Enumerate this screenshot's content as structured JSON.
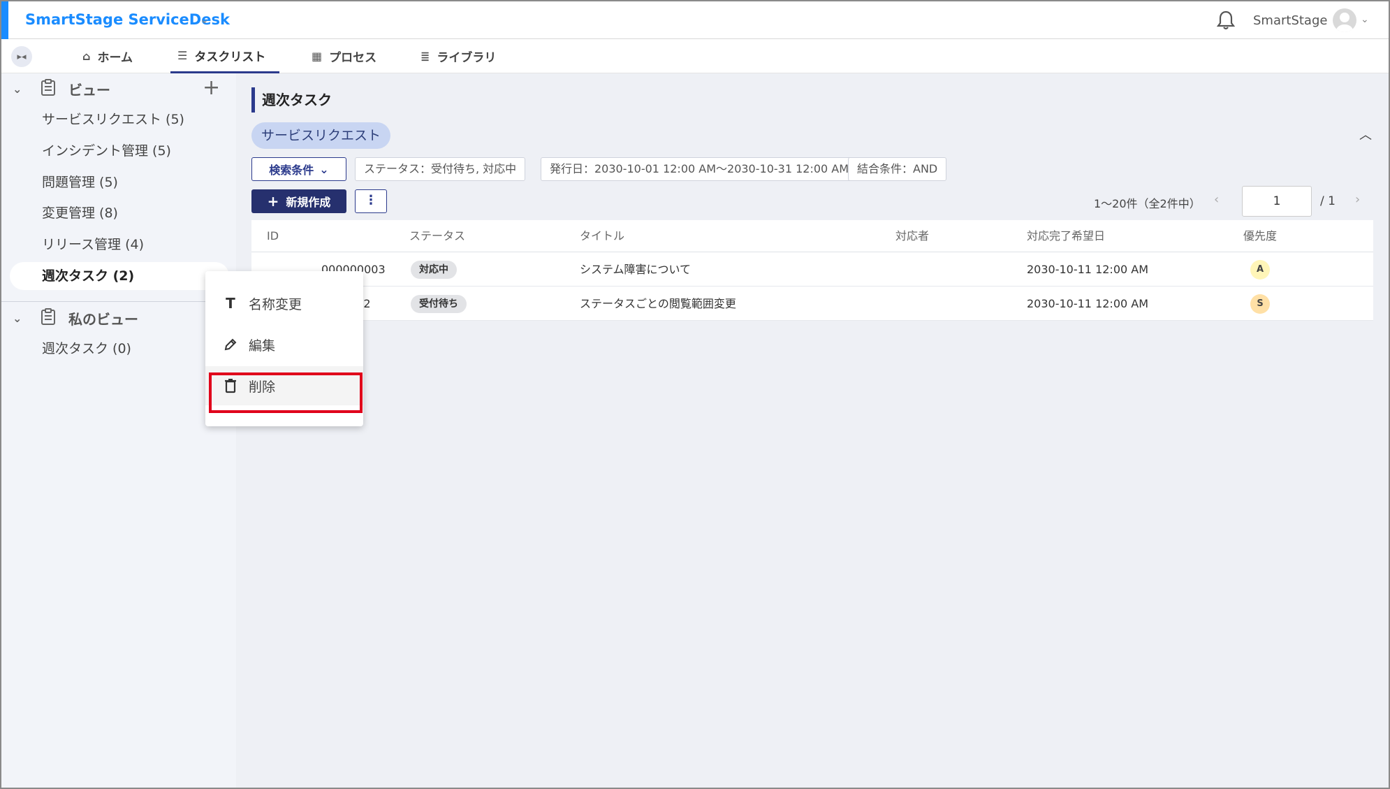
{
  "header": {
    "app_title": "SmartStage ServiceDesk",
    "user_name": "SmartStage",
    "icons": [
      "bell-icon",
      "avatar-icon",
      "chevron-down-icon"
    ]
  },
  "nav": {
    "tabs": [
      {
        "label": "ホーム",
        "icon": "home-icon",
        "active": false
      },
      {
        "label": "タスクリスト",
        "icon": "checklist-icon",
        "active": true
      },
      {
        "label": "プロセス",
        "icon": "building-icon",
        "active": false
      },
      {
        "label": "ライブラリ",
        "icon": "list-icon",
        "active": false
      }
    ]
  },
  "sidebar": {
    "views_title": "ビュー",
    "items": [
      {
        "label": "サービスリクエスト (5)"
      },
      {
        "label": "インシデント管理 (5)"
      },
      {
        "label": "問題管理 (5)"
      },
      {
        "label": "変更管理 (8)"
      },
      {
        "label": "リリース管理 (4)"
      },
      {
        "label": "週次タスク (2)",
        "active": true
      }
    ],
    "my_views_title": "私のビュー",
    "my_items": [
      {
        "label": "週次タスク (0)"
      }
    ]
  },
  "main": {
    "page_title": "週次タスク",
    "category_chip": "サービスリクエスト",
    "filter_button": "検索条件",
    "filters": [
      "ステータス：受付待ち, 対応中",
      "発行日：2030-10-01 12:00 AM〜2030-10-31 12:00 AM",
      "結合条件：AND"
    ],
    "new_button": "新規作成",
    "more_button": "⋮",
    "pager": {
      "summary": "1〜20件（全2件中）",
      "page": "1",
      "total": "/ 1"
    },
    "table": {
      "headers": [
        "ID",
        "ステータス",
        "タイトル",
        "対応者",
        "対応完了希望日",
        "優先度"
      ],
      "rows": [
        {
          "id": "000000003",
          "status": "対応中",
          "title": "システム障害について",
          "assignee": "",
          "due": "2030-10-11 12:00 AM",
          "priority": "A",
          "priority_color": "#fff5b8"
        },
        {
          "id": "002",
          "status": "受付待ち",
          "title": "ステータスごとの閲覧範囲変更",
          "assignee": "",
          "due": "2030-10-11 12:00 AM",
          "priority": "S",
          "priority_color": "#ffe0a6"
        }
      ]
    }
  },
  "context_menu": {
    "items": [
      {
        "label": "名称変更",
        "icon": "text-icon"
      },
      {
        "label": "編集",
        "icon": "pencil-icon"
      },
      {
        "label": "削除",
        "icon": "trash-icon",
        "highlighted": true
      }
    ]
  },
  "colors": {
    "accent": "#1a8cff",
    "primary": "#26306e",
    "highlight_box": "#e0001b"
  }
}
